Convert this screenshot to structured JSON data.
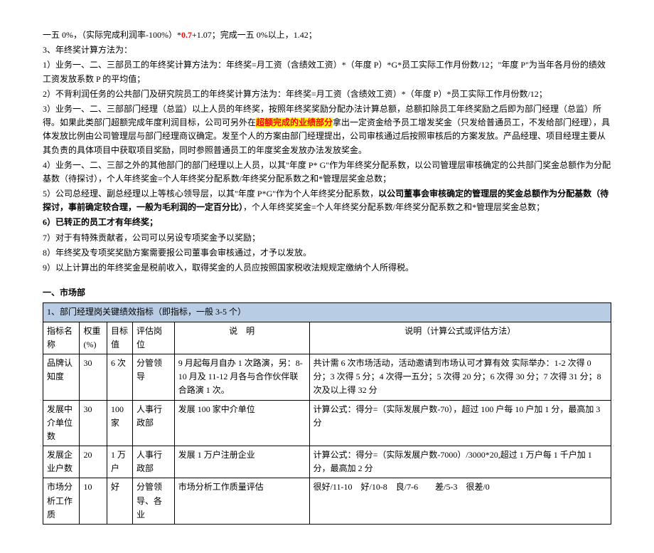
{
  "paragraphs": {
    "p0_a": "一五 0%，（实际完成利润率-100%）*",
    "p0_b": "0.7",
    "p0_c": "+1.07；完成一五 0%以上，1.42；",
    "p1": "3、年终奖计算方法为：",
    "p2": "1）业务一、二、三部员工的年终奖计算方法为：年终奖=月工资（含绩效工资）*（年度 P）*G*员工实际工作月份数/12；\"年度 P\"为当年各月份的绩效工资发放系数 P 的平均值；",
    "p3": "2）不背利润任务的公共部门及研究院员工的年终奖计算方法为：年终奖=月工资（含绩效工资）*（年度 P）*员工实际工作月份数/12；",
    "p4_a": "3）业务一、二、三部部门经理（总监）以上人员的年终奖，按照年终奖奖励分配办法计算总额，总额扣除员工年终奖励之后即为部门经理（总监）所得。如果此类部门超额完成年度利润目标，公司可另外在",
    "p4_b": "超额完成的业绩部分",
    "p4_c": "拿出一定资金给予员工增发奖金（只发给普通员工，不发给部门经理），具体发放比例由公司管理层与部门经理商议确定。发至个人的方案由部门经理提出，公司审核通过后按照审核后的方案发放。产品经理、项目经理主要从其负责的具体项目中获取项目奖励，同时参照普通员工的年度奖金发放办法发放奖金。",
    "p5": "4）业务一、二、三部之外的其他部门的部门经理以上人员，以其\"年度 P* G\"作为年终奖分配系数，以公司管理层审核确定的公共部门奖金总额作为分配基数（待探讨），个人年终奖金=个人年终奖分配系数/年终奖分配系数之和*管理层奖金总数；",
    "p6_a": "5）公司总经理、副总经理以上等核心领导层，以其\"年度 P*G\"作为个人年终奖分配系数，",
    "p6_b": "以公司董事会审核确定的管理层的奖金总额作为分配基数（待探讨，事前确定较合理，一般为毛利润的一定百分比）",
    "p6_c": "，个人年终奖奖金=个人年终奖分配系数/年终奖分配系数之和*管理层奖金总数；",
    "p7": "6）已转正的员工才有年终奖；",
    "p8": "7）对于有特殊贡献者，公司可以另设专项奖金予以奖励；",
    "p9": "8）年终奖及专项奖奖励方案需要报公司董事会审核通过，才予以发放。",
    "p10": "9）以上计算出的年终奖金是税前收入，取得奖金的人员应按照国家税收法规规定缴纳个人所得税。"
  },
  "section_title": "一、市场部",
  "table": {
    "title": "1、部门经理岗关键绩效指标（即指标，一般 3-5 个）",
    "headers": [
      "指标名称",
      "权重(%)",
      "目标值",
      "评估岗位",
      "说　明",
      "说明（计算公式或评估方法）"
    ],
    "rows": [
      {
        "c0": "品牌认知度",
        "c1": "30",
        "c2": "6 次",
        "c3": "分管领导",
        "c4": "9 月起每月自办 1 次路演，另：8-10 月及 11-12 月各与合作伙伴联合路演 1 次。",
        "c5": "共计需 6 次市场活动，活动邀请到市场认可才算有效\n实际举办：1-2 次得 0 分；3 次得 5 分；4 次得一五分；5 次得 20 分；6 次得 30 分；7 次得 31 分；8 次及以上得 32 分"
      },
      {
        "c0": "发展中介单位数",
        "c1": "30",
        "c2": "100 家",
        "c3": "人事行政部",
        "c4": "发展 100 家中介单位",
        "c5": "计算公式：得分=（实际发展户数-70），超过 100 户每 10 户加 1 分，最高加 3 分"
      },
      {
        "c0": "发展企业户数",
        "c1": "20",
        "c2": "1 万户",
        "c3": "人事行政部",
        "c4": "发展 1 万户注册企业",
        "c5": "计算公式：得分=（实际发展户数-7000）/3000*20,超过 1 万户每 1 千户加 1 分，最高加 2 分"
      },
      {
        "c0": "市场分析工作质",
        "c1": "10",
        "c2": "好",
        "c3": "分管领导、各业",
        "c4": "市场分析工作质量评估",
        "c5": "很好/11-10　好/10-8　良/7-6　　差/5-3　很差/0"
      }
    ]
  }
}
